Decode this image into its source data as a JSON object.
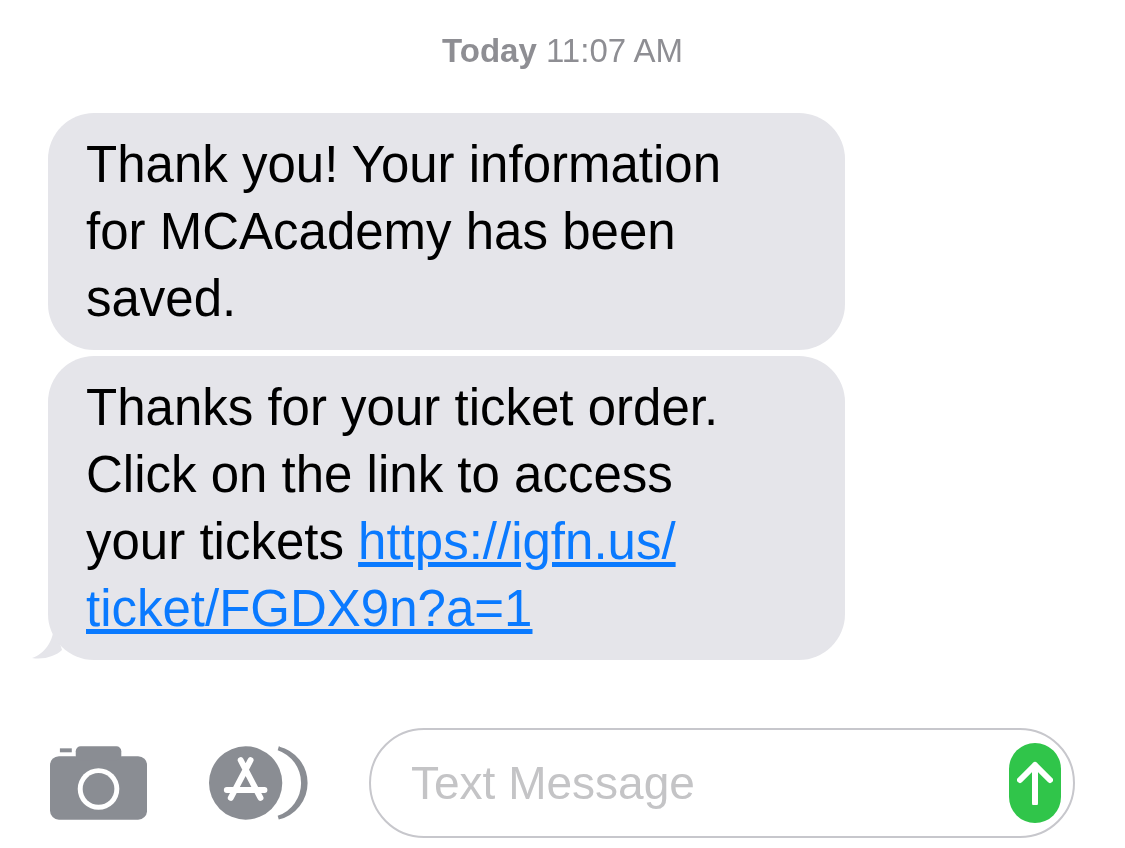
{
  "timestamp": {
    "day": "Today",
    "time": "11:07 AM"
  },
  "messages": [
    {
      "text": "Thank you! Your information for MCAcademy has been saved.",
      "tail": false
    },
    {
      "text": "Thanks for your ticket order. Click on the link to access your tickets ",
      "link_lines": [
        "https://igfn.us/",
        "ticket/FGDX9n?a=1"
      ],
      "tail": true
    }
  ],
  "composer": {
    "placeholder": "Text Message"
  }
}
